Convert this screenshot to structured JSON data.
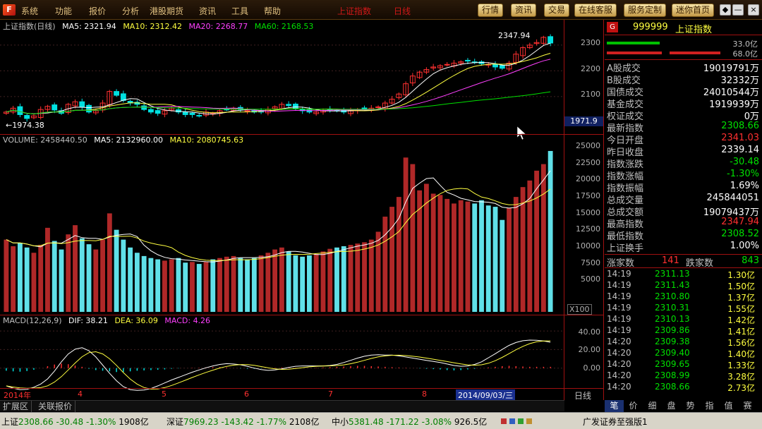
{
  "menubar": {
    "logo": "F",
    "items": [
      "系统",
      "功能",
      "报价",
      "分析",
      "港股期货",
      "资讯",
      "工具",
      "帮助"
    ],
    "center_text": [
      "上证指数",
      "日线"
    ],
    "buttons": [
      "行情",
      "资讯",
      "交易",
      "在线客服",
      "服务定制",
      "迷你首页"
    ],
    "window_controls": [
      "◆",
      "—",
      "□",
      "×"
    ]
  },
  "price_legend": {
    "title": "上证指数(日线)",
    "ma5": "MA5: 2321.94",
    "ma10": "MA10: 2312.42",
    "ma20": "MA20: 2268.77",
    "ma60": "MA60: 2168.53"
  },
  "price_axis": [
    "2300",
    "2200",
    "2100"
  ],
  "price_annotations": {
    "high": "2347.94",
    "low": "←1974.38",
    "cursor_price": "1971.9"
  },
  "volume_legend": {
    "volume": "VOLUME: 2458440.50",
    "ma5": "MA5: 2132960.00",
    "ma10": "MA10: 2080745.63"
  },
  "volume_axis": [
    "25000",
    "22500",
    "20000",
    "17500",
    "15000",
    "12500",
    "10000",
    "7500",
    "5000"
  ],
  "volume_unit": "X100",
  "macd_legend": {
    "title": "MACD(12,26,9)",
    "dif": "DIF: 38.21",
    "dea": "DEA: 36.09",
    "macd": "MACD: 4.26"
  },
  "macd_axis": [
    "40.00",
    "20.00",
    "0.00"
  ],
  "x_axis": {
    "labels": [
      "2014年",
      "4",
      "5",
      "6",
      "7",
      "8"
    ],
    "cursor_date": "2014/09/03/三",
    "period": "日线"
  },
  "stock": {
    "badge": "G",
    "code": "999999",
    "name": "上证指数",
    "up_pct": "33.0亿",
    "down_pct": "68.0亿"
  },
  "info_rows": [
    {
      "label": "A股成交",
      "value": "19019791万",
      "color": "#ffffff"
    },
    {
      "label": "B股成交",
      "value": "32332万",
      "color": "#ffffff"
    },
    {
      "label": "国债成交",
      "value": "24010544万",
      "color": "#ffffff"
    },
    {
      "label": "基金成交",
      "value": "1919939万",
      "color": "#ffffff"
    },
    {
      "label": "权证成交",
      "value": "0万",
      "color": "#ffffff"
    },
    {
      "label": "最新指数",
      "value": "2308.66",
      "color": "#00e000"
    },
    {
      "label": "今日开盘",
      "value": "2341.03",
      "color": "#ff3030"
    },
    {
      "label": "昨日收盘",
      "value": "2339.14",
      "color": "#ffffff"
    },
    {
      "label": "指数涨跌",
      "value": "-30.48",
      "color": "#00e000"
    },
    {
      "label": "指数涨幅",
      "value": "-1.30%",
      "color": "#00e000"
    },
    {
      "label": "指数振幅",
      "value": "1.69%",
      "color": "#ffffff"
    },
    {
      "label": "总成交量",
      "value": "245844051",
      "color": "#ffffff"
    },
    {
      "label": "总成交额",
      "value": "19079437万",
      "color": "#ffffff"
    },
    {
      "label": "最高指数",
      "value": "2347.94",
      "color": "#ff3030"
    },
    {
      "label": "最低指数",
      "value": "2308.52",
      "color": "#00e000"
    },
    {
      "label": "上证换手",
      "value": "1.00%",
      "color": "#ffffff"
    }
  ],
  "breadth": {
    "up_label": "涨家数",
    "up_value": "141",
    "down_label": "跌家数",
    "down_value": "843"
  },
  "ticks": [
    {
      "time": "14:19",
      "price": "2311.13",
      "change": "1.30亿"
    },
    {
      "time": "14:19",
      "price": "2311.43",
      "change": "1.50亿"
    },
    {
      "time": "14:19",
      "price": "2310.80",
      "change": "1.37亿"
    },
    {
      "time": "14:19",
      "price": "2310.31",
      "change": "1.55亿"
    },
    {
      "time": "14:19",
      "price": "2310.13",
      "change": "1.42亿"
    },
    {
      "time": "14:19",
      "price": "2309.86",
      "change": "1.41亿"
    },
    {
      "time": "14:20",
      "price": "2309.38",
      "change": "1.56亿"
    },
    {
      "time": "14:20",
      "price": "2309.40",
      "change": "1.40亿"
    },
    {
      "time": "14:20",
      "price": "2309.65",
      "change": "1.33亿"
    },
    {
      "time": "14:20",
      "price": "2308.99",
      "change": "3.28亿"
    },
    {
      "time": "14:20",
      "price": "2308.66",
      "change": "2.73亿"
    }
  ],
  "side_tabs": [
    "笔",
    "价",
    "细",
    "盘",
    "势",
    "指",
    "值",
    "赛"
  ],
  "bottom_tabs": [
    "扩展区",
    "关联报价"
  ],
  "status": {
    "sh_label": "上证",
    "sh_value": "2308.66",
    "sh_change": "-30.48",
    "sh_pct": "-1.30%",
    "sh_amount": "1908亿",
    "sz_label": "深证",
    "sz_value": "7969.23",
    "sz_change": "-143.42",
    "sz_pct": "-1.77%",
    "sz_amount": "2108亿",
    "zx_label": "中小",
    "zx_value": "5381.48",
    "zx_change": "-171.22",
    "zx_pct": "-3.08%",
    "zx_amount": "926.5亿",
    "broker": "广发证券至强版1"
  },
  "colors": {
    "up": "#ff3030",
    "down": "#00e0e0",
    "ma5": "#ffffff",
    "ma10": "#ffff40",
    "ma20": "#ff40ff",
    "ma60": "#00e000"
  },
  "chart_data": {
    "type": "candlestick",
    "index_close_series": [
      2040,
      2055,
      2030,
      2015,
      2025,
      2050,
      2062,
      2048,
      2035,
      2070,
      2080,
      2060,
      2040,
      2045,
      2075,
      2120,
      2105,
      2085,
      2075,
      2070,
      2050,
      2040,
      2035,
      2045,
      2055,
      2040,
      2030,
      2030,
      2025,
      2040,
      2035,
      2045,
      2050,
      2055,
      2050,
      2045,
      2040,
      2040,
      2050,
      2060,
      2070,
      2065,
      2055,
      2045,
      2040,
      2040,
      2045,
      2050,
      2045,
      2040,
      2045,
      2050,
      2050,
      2055,
      2060,
      2075,
      2090,
      2110,
      2150,
      2180,
      2195,
      2205,
      2215,
      2220,
      2225,
      2230,
      2235,
      2238,
      2232,
      2228,
      2225,
      2215,
      2210,
      2230,
      2265,
      2290,
      2300,
      2310,
      2330,
      2308
    ],
    "volume_series": [
      110,
      100,
      105,
      98,
      90,
      102,
      128,
      108,
      95,
      118,
      132,
      112,
      103,
      95,
      110,
      150,
      125,
      110,
      98,
      90,
      85,
      82,
      80,
      78,
      80,
      82,
      75,
      76,
      73,
      76,
      80,
      82,
      84,
      85,
      82,
      80,
      82,
      86,
      90,
      95,
      98,
      92,
      86,
      84,
      86,
      88,
      92,
      96,
      98,
      100,
      102,
      104,
      106,
      110,
      122,
      145,
      160,
      175,
      235,
      225,
      185,
      195,
      180,
      178,
      172,
      165,
      170,
      168,
      165,
      170,
      162,
      160,
      140,
      158,
      175,
      190,
      200,
      215,
      225,
      245
    ],
    "macd_series": [
      -8,
      -10,
      -11,
      -9,
      -5,
      0,
      6,
      11,
      14,
      12,
      8,
      4,
      -2,
      -6,
      -8,
      -10,
      -12,
      -12,
      -10,
      -8,
      -7,
      -6,
      -5,
      -4,
      -2,
      -1,
      0,
      1,
      1,
      2,
      3,
      3,
      2,
      0,
      -1,
      -2,
      -2,
      -1,
      0,
      1,
      2,
      2,
      1,
      0,
      0,
      1,
      2,
      3,
      4,
      5,
      6,
      7,
      7,
      6,
      5,
      4,
      3,
      2,
      1,
      0,
      -1,
      -2,
      -3,
      -4,
      -6,
      -7,
      -6,
      -4,
      -2,
      0,
      2,
      4,
      6,
      7,
      6,
      5,
      4,
      4,
      4,
      4
    ],
    "ma_lines": [
      "MA5",
      "MA10",
      "MA20",
      "MA60"
    ]
  }
}
